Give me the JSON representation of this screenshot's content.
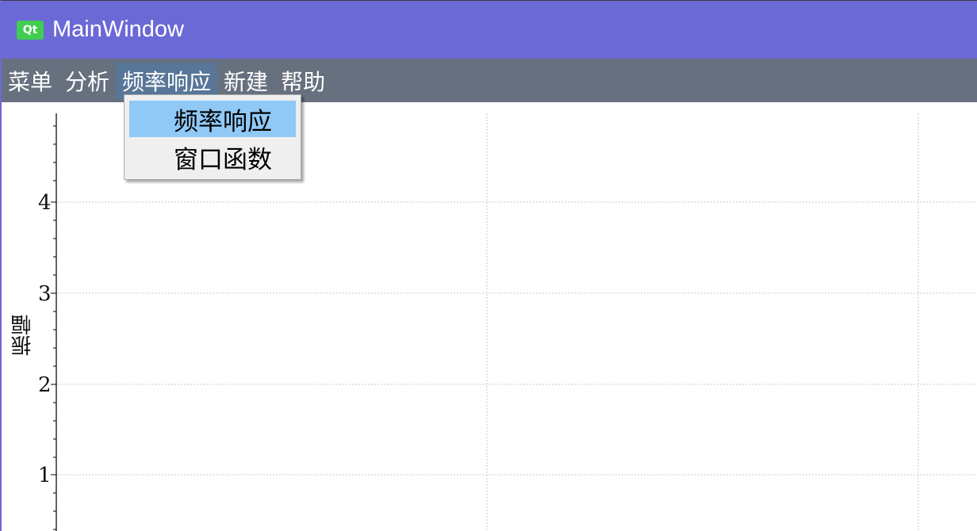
{
  "window": {
    "title": "MainWindow",
    "logo_text": "Qt"
  },
  "menubar": {
    "items": [
      {
        "label": "菜单"
      },
      {
        "label": "分析"
      },
      {
        "label": "频率响应",
        "active": true
      },
      {
        "label": "新建"
      },
      {
        "label": "帮助"
      }
    ]
  },
  "dropdown": {
    "items": [
      {
        "label": "频率响应",
        "highlighted": true
      },
      {
        "label": "窗口函数"
      }
    ]
  },
  "plot": {
    "ylabel": "振幅",
    "y_ticks": [
      "4",
      "3",
      "2",
      "1"
    ]
  },
  "colors": {
    "titlebar": "#6b69d6",
    "menubar": "#67707e",
    "menu_active": "#587698",
    "dropdown_highlight": "#90c8f6",
    "qt_green": "#41cd52"
  }
}
